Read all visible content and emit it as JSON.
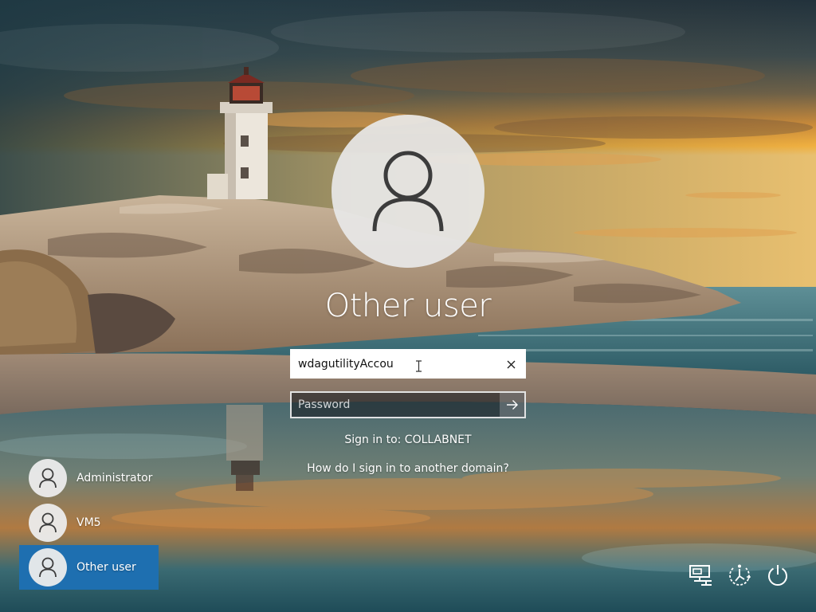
{
  "signin": {
    "title": "Other user",
    "username_value": "wdagutilityAccou",
    "password_placeholder": "Password",
    "sign_in_to": "Sign in to: COLLABNET",
    "other_domain_link": "How do I sign in to another domain?"
  },
  "user_list": [
    {
      "name": "Administrator",
      "selected": false
    },
    {
      "name": "VM5",
      "selected": false
    },
    {
      "name": "Other user",
      "selected": true
    }
  ],
  "system_buttons": {
    "network_icon": "network-icon",
    "ease_of_access_icon": "ease-of-access-icon",
    "power_icon": "power-icon"
  },
  "colors": {
    "selected_user_background": "#1e6fb0",
    "avatar_background": "#e8e8e8",
    "text": "#ffffff"
  }
}
